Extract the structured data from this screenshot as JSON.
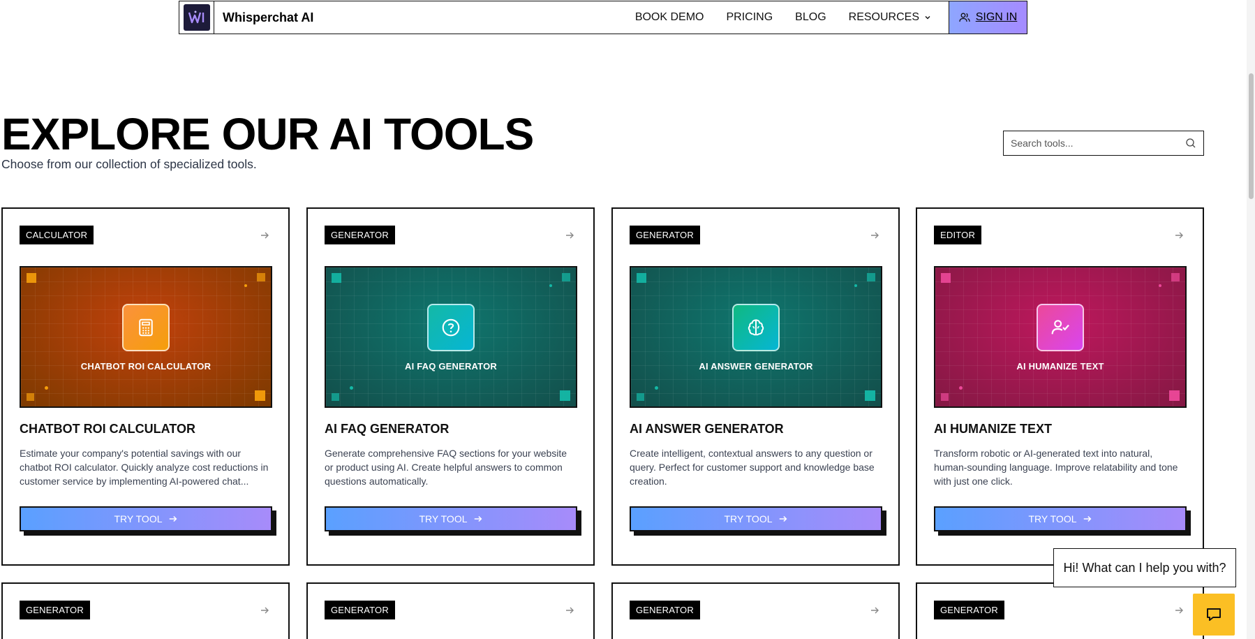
{
  "nav": {
    "brand": "Whisperchat AI",
    "links": [
      "BOOK DEMO",
      "PRICING",
      "BLOG",
      "RESOURCES"
    ],
    "signin": "SIGN IN"
  },
  "hero": {
    "title": "EXPLORE OUR AI TOOLS",
    "subtitle": "Choose from our collection of specialized tools."
  },
  "search": {
    "placeholder": "Search tools..."
  },
  "cards": [
    {
      "tag": "CALCULATOR",
      "banner_title": "CHATBOT ROI CALCULATOR",
      "title": "CHATBOT ROI CALCULATOR",
      "description": "Estimate your company's potential savings with our chatbot ROI calculator. Quickly analyze cost reductions in customer service by implementing AI-powered chat...",
      "button": "TRY TOOL",
      "icon": "calculator-icon",
      "colors": {
        "from": "#c2410c",
        "to": "#7c3a00",
        "icon_from": "#fb923c",
        "icon_to": "#f59e0b",
        "sq": "#f59e0b"
      }
    },
    {
      "tag": "GENERATOR",
      "banner_title": "AI FAQ GENERATOR",
      "title": "AI FAQ GENERATOR",
      "description": "Generate comprehensive FAQ sections for your website or product using AI. Create helpful answers to common questions automatically.",
      "button": "TRY TOOL",
      "icon": "question-icon",
      "colors": {
        "from": "#0f766e",
        "to": "#134e4a",
        "icon_from": "#14b8a6",
        "icon_to": "#06b6d4",
        "sq": "#14b8a6"
      }
    },
    {
      "tag": "GENERATOR",
      "banner_title": "AI ANSWER GENERATOR",
      "title": "AI ANSWER GENERATOR",
      "description": "Create intelligent, contextual answers to any question or query. Perfect for customer support and knowledge base creation.",
      "button": "TRY TOOL",
      "icon": "brain-icon",
      "colors": {
        "from": "#0f766e",
        "to": "#134e4a",
        "icon_from": "#10b981",
        "icon_to": "#06b6d4",
        "sq": "#14b8a6"
      }
    },
    {
      "tag": "EDITOR",
      "banner_title": "AI HUMANIZE TEXT",
      "title": "AI HUMANIZE TEXT",
      "description": "Transform robotic or AI-generated text into natural, human-sounding language. Improve relatability and tone with just one click.",
      "button": "TRY TOOL",
      "icon": "user-check-icon",
      "colors": {
        "from": "#be185d",
        "to": "#831843",
        "icon_from": "#ec4899",
        "icon_to": "#d946ef",
        "sq": "#ec4899"
      }
    }
  ],
  "row2_tags": [
    "GENERATOR",
    "GENERATOR",
    "GENERATOR",
    "GENERATOR"
  ],
  "chat": {
    "message": "Hi! What can I help you with?"
  }
}
